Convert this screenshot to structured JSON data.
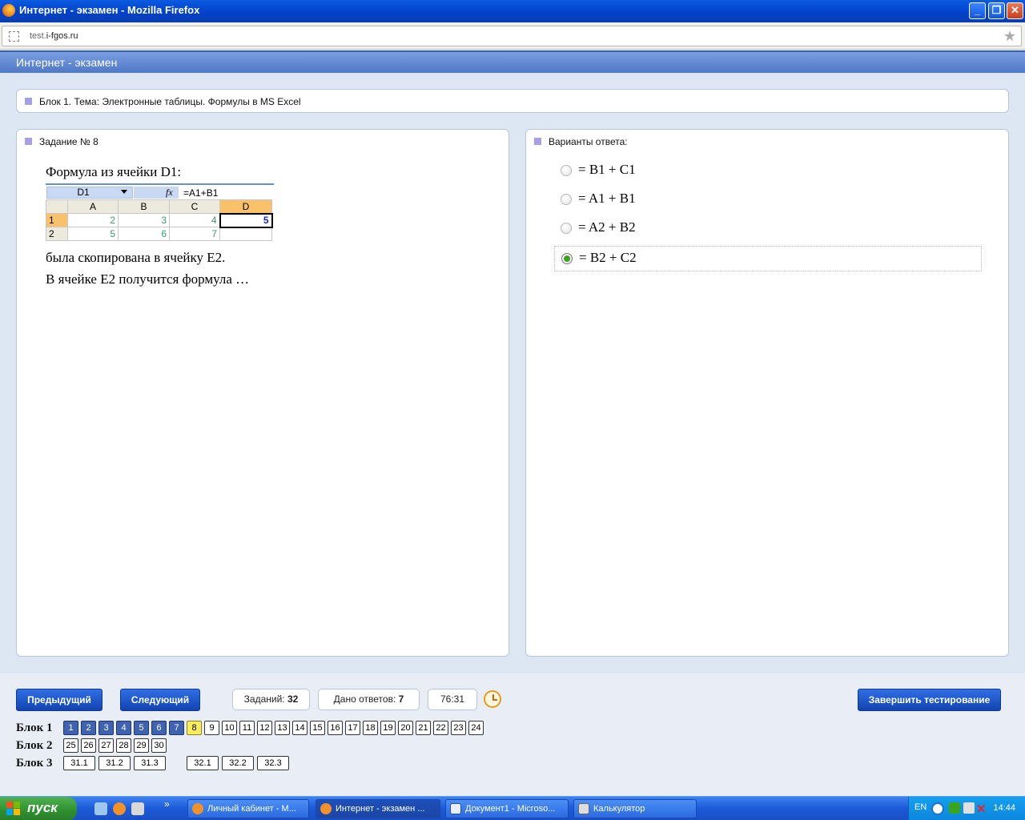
{
  "window": {
    "title": "Интернет - экзамен - Mozilla Firefox",
    "min_label": "_",
    "max_label": "❐",
    "close_label": "✕"
  },
  "browser": {
    "url_prefix": "test.",
    "url_domain": "i-fgos.ru",
    "star_icon": "★"
  },
  "app": {
    "header": "Интернет - экзамен"
  },
  "topic": {
    "text": "Блок 1. Тема: Электронные таблицы. Формулы в MS Excel"
  },
  "task": {
    "title": "Задание № 8",
    "line1": "Формула из ячейки D1:",
    "line2": "была скопирована в ячейку E2.",
    "line3": "В ячейке E2 получится формула …",
    "excel": {
      "name_box": "D1",
      "fx": "fx",
      "formula": "=A1+B1",
      "columns": [
        "A",
        "B",
        "C",
        "D"
      ],
      "rows": [
        {
          "header": "1",
          "cells": [
            "2",
            "3",
            "4",
            "5"
          ]
        },
        {
          "header": "2",
          "cells": [
            "5",
            "6",
            "7",
            ""
          ]
        }
      ]
    }
  },
  "answers": {
    "title": "Варианты ответа:",
    "options": [
      {
        "text": "= B1 + C1",
        "selected": false
      },
      {
        "text": "= A1 + B1",
        "selected": false
      },
      {
        "text": "= A2 + B2",
        "selected": false
      },
      {
        "text": "= B2 + C2",
        "selected": true
      }
    ]
  },
  "controls": {
    "prev_label": "Предыдущий",
    "next_label": "Следующий",
    "tasks_label": "Заданий:",
    "tasks_count": "32",
    "answered_label": "Дано ответов:",
    "answered_count": "7",
    "timer": "76:31",
    "finish_label": "Завершить тестирование"
  },
  "blocks": [
    {
      "label": "Блок 1",
      "items": [
        "1",
        "2",
        "3",
        "4",
        "5",
        "6",
        "7",
        "8",
        "9",
        "10",
        "11",
        "12",
        "13",
        "14",
        "15",
        "16",
        "17",
        "18",
        "19",
        "20",
        "21",
        "22",
        "23",
        "24"
      ],
      "answered": 7,
      "current": "8"
    },
    {
      "label": "Блок 2",
      "items": [
        "25",
        "26",
        "27",
        "28",
        "29",
        "30"
      ]
    },
    {
      "label": "Блок 3",
      "items": [
        "31.1",
        "31.2",
        "31.3",
        "32.1",
        "32.2",
        "32.3"
      ]
    }
  ],
  "taskbar": {
    "start_label": "пуск",
    "tasks": [
      {
        "label": "Личный кабинет - М...",
        "active": false
      },
      {
        "label": "Интернет - экзамен ...",
        "active": true
      },
      {
        "label": "Документ1 - Microso...",
        "active": false
      },
      {
        "label": "Калькулятор",
        "active": false
      }
    ],
    "lang": "EN",
    "clock": "14:44",
    "expand": "»"
  }
}
